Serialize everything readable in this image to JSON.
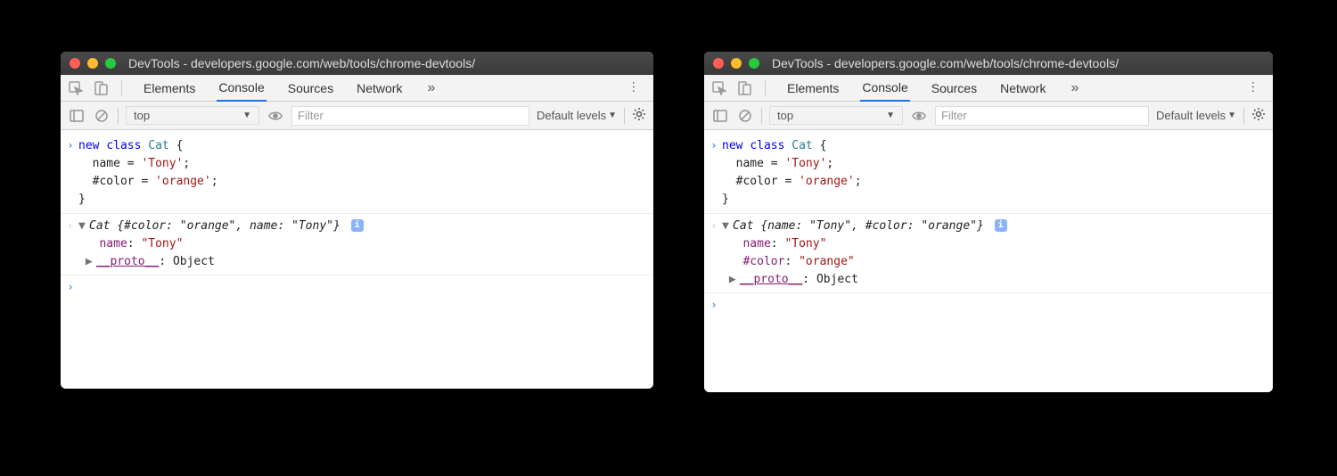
{
  "windows": [
    {
      "id": "left",
      "title": "DevTools - developers.google.com/web/tools/chrome-devtools/",
      "tabs": [
        "Elements",
        "Console",
        "Sources",
        "Network"
      ],
      "activeTab": "Console",
      "toolbar": {
        "context": "top",
        "filterPlaceholder": "Filter",
        "levels": "Default levels"
      },
      "input": {
        "line1_kw": "new",
        "line1_kw2": "class",
        "line1_name": "Cat",
        "line1_brace": " {",
        "line2_pre": "  name = ",
        "line2_val": "'Tony'",
        "line2_post": ";",
        "line3_pre": "  #color = ",
        "line3_val": "'orange'",
        "line3_post": ";",
        "line4": "}"
      },
      "output": {
        "header_name": "Cat ",
        "header_open": "{",
        "header_k1": "#color",
        "header_sep1": ": ",
        "header_v1": "\"orange\"",
        "header_comma": ", ",
        "header_k2": "name",
        "header_sep2": ": ",
        "header_v2": "\"Tony\"",
        "header_close": "}",
        "prop1_k": "name",
        "prop1_sep": ": ",
        "prop1_v": "\"Tony\"",
        "proto_label": "__proto__",
        "proto_sep": ": ",
        "proto_val": "Object"
      }
    },
    {
      "id": "right",
      "title": "DevTools - developers.google.com/web/tools/chrome-devtools/",
      "tabs": [
        "Elements",
        "Console",
        "Sources",
        "Network"
      ],
      "activeTab": "Console",
      "toolbar": {
        "context": "top",
        "filterPlaceholder": "Filter",
        "levels": "Default levels"
      },
      "input": {
        "line1_kw": "new",
        "line1_kw2": "class",
        "line1_name": "Cat",
        "line1_brace": " {",
        "line2_pre": "  name = ",
        "line2_val": "'Tony'",
        "line2_post": ";",
        "line3_pre": "  #color = ",
        "line3_val": "'orange'",
        "line3_post": ";",
        "line4": "}"
      },
      "output": {
        "header_name": "Cat ",
        "header_open": "{",
        "header_k1": "name",
        "header_sep1": ": ",
        "header_v1": "\"Tony\"",
        "header_comma": ", ",
        "header_k2": "#color",
        "header_sep2": ": ",
        "header_v2": "\"orange\"",
        "header_close": "}",
        "prop1_k": "name",
        "prop1_sep": ": ",
        "prop1_v": "\"Tony\"",
        "prop2_k": "#color",
        "prop2_sep": ": ",
        "prop2_v": "\"orange\"",
        "proto_label": "__proto__",
        "proto_sep": ": ",
        "proto_val": "Object"
      }
    }
  ]
}
